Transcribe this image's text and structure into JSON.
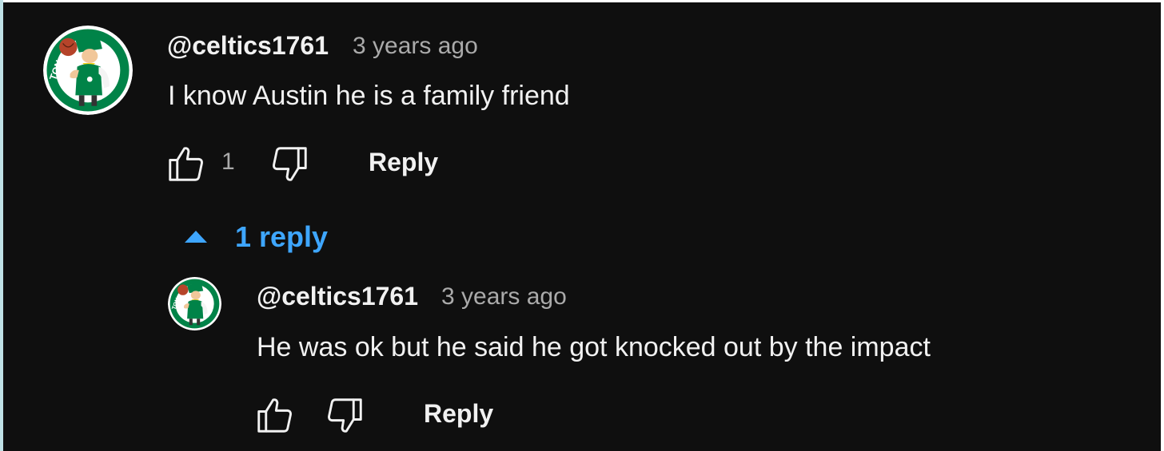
{
  "comment": {
    "author": "@celtics1761",
    "time": "3 years ago",
    "text": "I know Austin he is a family friend",
    "like_count": "1",
    "reply_label": "Reply",
    "avatar_icon": "celtics-leprechaun-logo"
  },
  "replies_toggle": {
    "label": "1 reply",
    "icon": "caret-up-icon",
    "color": "#3ea6ff"
  },
  "reply": {
    "author": "@celtics1761",
    "time": "3 years ago",
    "text": "He was ok but he said he got knocked out by the impact",
    "reply_label": "Reply",
    "avatar_icon": "celtics-leprechaun-logo"
  },
  "colors": {
    "background": "#0f0f0f",
    "text": "#f1f1f1",
    "secondary_text": "#aaaaaa",
    "accent": "#3ea6ff"
  }
}
